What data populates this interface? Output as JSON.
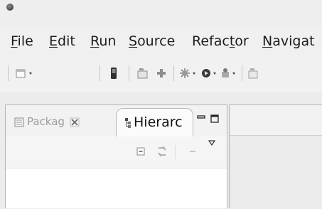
{
  "menu": [
    {
      "pre": "",
      "mn": "F",
      "post": "ile"
    },
    {
      "pre": "",
      "mn": "E",
      "post": "dit"
    },
    {
      "pre": "",
      "mn": "R",
      "post": "un"
    },
    {
      "pre": "",
      "mn": "S",
      "post": "ource"
    },
    {
      "pre": "Refac",
      "mn": "t",
      "post": "or"
    },
    {
      "pre": "",
      "mn": "N",
      "post": "avigat"
    }
  ],
  "tabs": {
    "packages": "Packag",
    "hierarchy": "Hierarc"
  }
}
